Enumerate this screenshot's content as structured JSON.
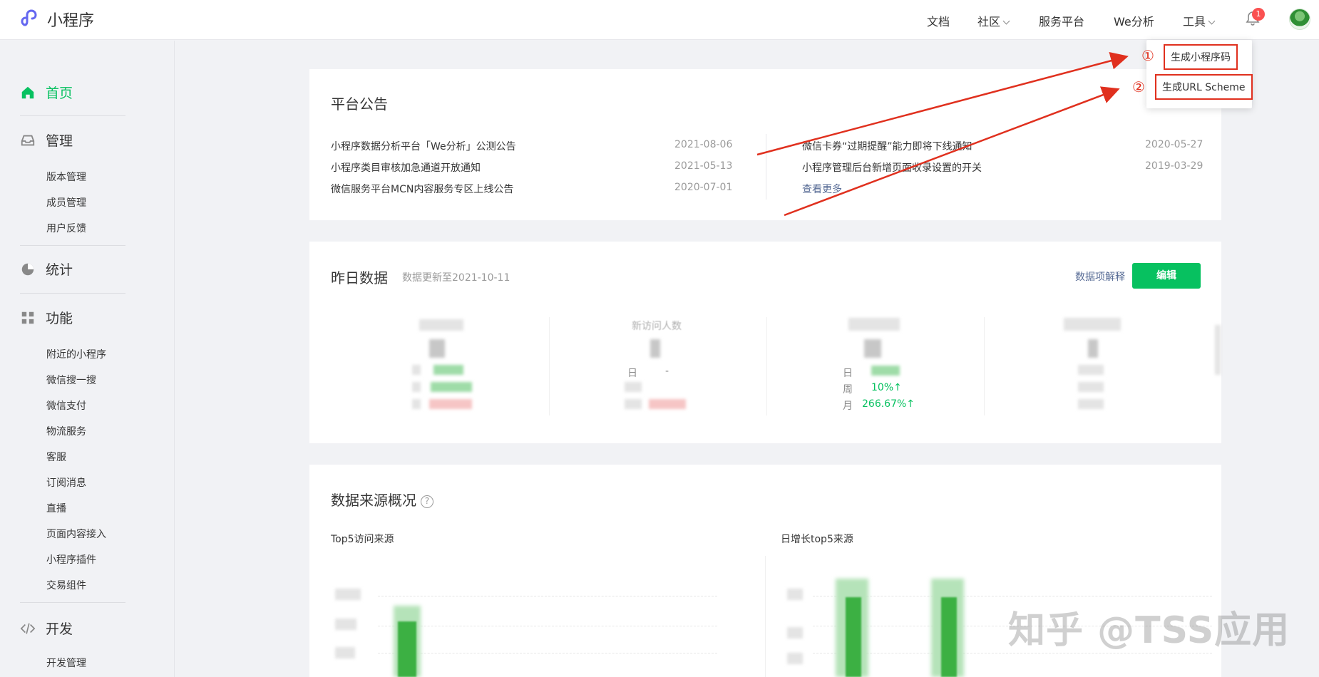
{
  "app": {
    "title": "小程序"
  },
  "topnav": {
    "items": [
      {
        "label": "文档"
      },
      {
        "label": "社区",
        "has_dropdown": true
      },
      {
        "label": "服务平台"
      },
      {
        "label": "We分析"
      },
      {
        "label": "工具",
        "has_dropdown": true
      }
    ],
    "notification_count": "1"
  },
  "tools_dropdown": {
    "items": [
      {
        "marker": "①",
        "label": "生成小程序码"
      },
      {
        "marker": "②",
        "label": "生成URL Scheme"
      }
    ]
  },
  "sidebar": {
    "sections": [
      {
        "label": "首页",
        "icon": "home-icon",
        "active": true,
        "items": []
      },
      {
        "label": "管理",
        "icon": "inbox-icon",
        "items": [
          "版本管理",
          "成员管理",
          "用户反馈"
        ]
      },
      {
        "label": "统计",
        "icon": "pie-chart-icon",
        "items": []
      },
      {
        "label": "功能",
        "icon": "grid-icon",
        "items": [
          "附近的小程序",
          "微信搜一搜",
          "微信支付",
          "物流服务",
          "客服",
          "订阅消息",
          "直播",
          "页面内容接入",
          "小程序插件",
          "交易组件"
        ]
      },
      {
        "label": "开发",
        "icon": "code-icon",
        "items": [
          "开发管理"
        ]
      }
    ]
  },
  "announcements": {
    "title": "平台公告",
    "left": [
      {
        "text": "小程序数据分析平台「We分析」公测公告",
        "date": "2021-08-06"
      },
      {
        "text": "小程序类目审核加急通道开放通知",
        "date": "2021-05-13"
      },
      {
        "text": "微信服务平台MCN内容服务专区上线公告",
        "date": "2020-07-01"
      }
    ],
    "right": [
      {
        "text": "微信卡券“过期提醒”能力即将下线通知",
        "date": "2020-05-27"
      },
      {
        "text": "小程序管理后台新增页面收录设置的开关",
        "date": "2019-03-29"
      }
    ],
    "more": "查看更多"
  },
  "yesterday": {
    "title": "昨日数据",
    "updated": "数据更新至2021-10-11",
    "explain_link": "数据项解释",
    "edit_button": "编辑",
    "visible_label": "新访问人数",
    "day_label": "日",
    "week_label": "周",
    "month_label": "月",
    "week_value": "10%↑",
    "month_value": "266.67%↑",
    "colors": {
      "up": "#07c160",
      "down": "#fa5151"
    }
  },
  "sources": {
    "title": "数据来源概况",
    "help_icon": "?",
    "left_chart_title": "Top5访问来源",
    "right_chart_title": "日增长top5来源"
  },
  "watermark": "知乎 @TSS应用",
  "colors": {
    "brand": "#07c160",
    "annotation": "#e0301e",
    "link": "#576b95"
  }
}
